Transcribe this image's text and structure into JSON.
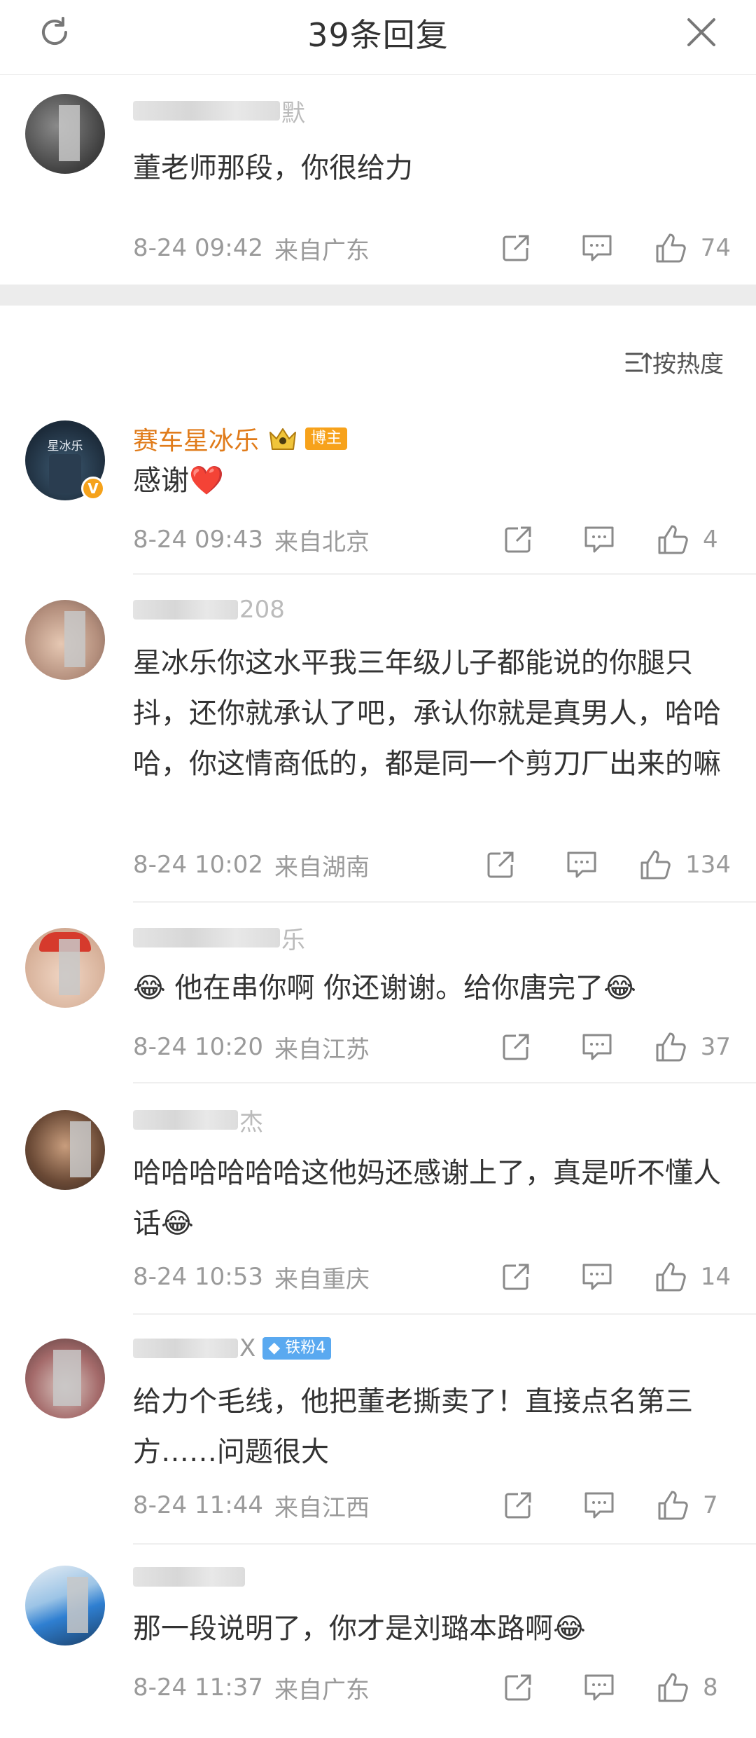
{
  "header": {
    "title": "39条回复"
  },
  "top_comment": {
    "name_tail": "默",
    "text": "董老师那段，你很给力",
    "time": "8-24 09:42",
    "location": "来自广东",
    "likes": "74"
  },
  "sort": {
    "label": "按热度"
  },
  "comments": [
    {
      "name": "赛车星冰乐",
      "tag": "博主",
      "avatar_text": "星冰乐",
      "text": "感谢❤️",
      "time": "8-24 09:43",
      "location": "来自北京",
      "likes": "4"
    },
    {
      "name_tail": "208",
      "text": "星冰乐你这水平我三年级儿子都能说的你腿只抖，还你就承认了吧，承认你就是真男人，哈哈哈，你这情商低的，都是同一个剪刀厂出来的嘛",
      "time": "8-24 10:02",
      "location": "来自湖南",
      "likes": "134"
    },
    {
      "name_tail": "乐",
      "text_pre": "😂 ",
      "text": "他在串你啊 你还谢谢。给你唐完了😂",
      "time": "8-24 10:20",
      "location": "来自江苏",
      "likes": "37"
    },
    {
      "name_tail": "杰",
      "text": "哈哈哈哈哈哈这他妈还感谢上了，真是听不懂人话😂",
      "time": "8-24 10:53",
      "location": "来自重庆",
      "likes": "14"
    },
    {
      "name_tail": "X",
      "tag": "铁粉4",
      "text": "给力个毛线，他把董老撕卖了！直接点名第三方……问题很大",
      "time": "8-24 11:44",
      "location": "来自江西",
      "likes": "7"
    },
    {
      "name_tail": "",
      "text": "那一段说明了，你才是刘璐本路啊😂",
      "time": "8-24 11:37",
      "location": "来自广东",
      "likes": "8"
    }
  ],
  "colors": {
    "accent": "#f5a21b",
    "link": "#e07b1a",
    "fan_tag": "#5aa9f0"
  },
  "icons": [
    "refresh-icon",
    "close-icon",
    "share-icon",
    "reply-icon",
    "like-icon",
    "sort-icon"
  ]
}
